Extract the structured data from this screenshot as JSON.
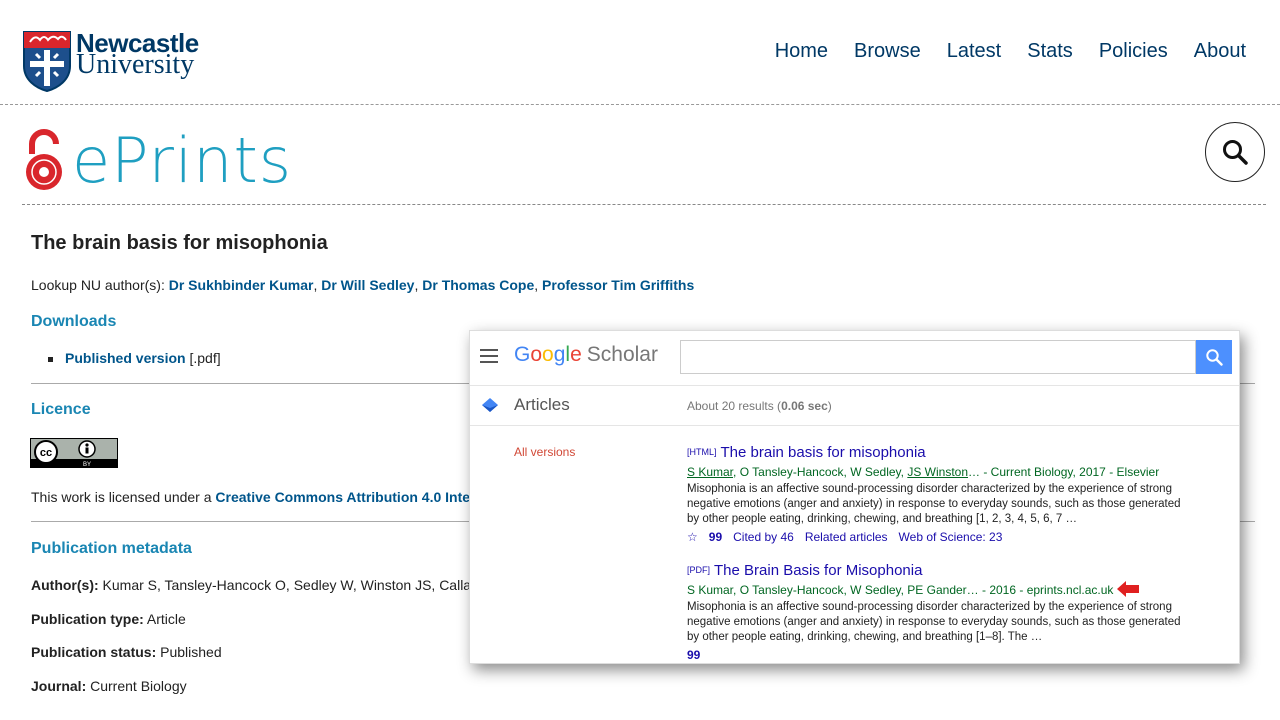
{
  "header": {
    "logo_line1": "Newcastle",
    "logo_line2": "University",
    "nav": [
      "Home",
      "Browse",
      "Latest",
      "Stats",
      "Policies",
      "About"
    ],
    "eprints_word": "ePrints"
  },
  "record": {
    "title": "The brain basis for misophonia",
    "lookup_label": "Lookup NU author(s): ",
    "authors": [
      "Dr Sukhbinder Kumar",
      "Dr Will Sedley",
      "Dr Thomas Cope",
      "Professor Tim Griffiths"
    ],
    "downloads_heading": "Downloads",
    "download_label": "Published version",
    "download_ext": " [.pdf]",
    "licence_heading": "Licence",
    "cc_badge": "CC BY",
    "license_prefix": "This work is licensed under a ",
    "license_link": "Creative Commons Attribution 4.0 Inte",
    "metadata_heading": "Publication metadata",
    "metadata": [
      {
        "label": "Author(s):",
        "value": "Kumar S, Tansley-Hancock O, Sedley W, Winston JS, Calla"
      },
      {
        "label": "Publication type:",
        "value": "Article"
      },
      {
        "label": "Publication status:",
        "value": "Published"
      },
      {
        "label": "Journal:",
        "value": "Current Biology"
      }
    ]
  },
  "scholar": {
    "logo_letters": [
      "G",
      "o",
      "o",
      "g",
      "l",
      "e"
    ],
    "logo_suffix": "Scholar",
    "search_value": "",
    "articles_label": "Articles",
    "results_prefix": "About 20 results (",
    "results_time": "0.06 sec",
    "results_suffix": ")",
    "all_versions": "All versions",
    "results": [
      {
        "tag": "[HTML]",
        "title": "The brain basis for misophonia",
        "src_author1": "S Kumar",
        "src_mid": ", O Tansley-Hancock, W Sedley, ",
        "src_author2": "JS Winston",
        "src_tail": "… - Current Biology, 2017 - Elsevier",
        "snippet": "Misophonia is an affective sound-processing disorder characterized by the experience of strong negative emotions (anger and anxiety) in response to everyday sounds, such as those generated by other people eating, drinking, chewing, and breathing [1, 2, 3, 4, 5, 6, 7 …",
        "cited_by": "Cited by 46",
        "related": "Related articles",
        "wos": "Web of Science: 23"
      },
      {
        "tag": "[PDF]",
        "title": "The Brain Basis for Misophonia",
        "src": "S Kumar, O Tansley-Hancock, W Sedley, PE Gander… - 2016 - eprints.ncl.ac.uk",
        "snippet": "Misophonia is an affective sound-processing disorder characterized by the experience of strong negative emotions (anger and anxiety) in response to everyday sounds, such as those generated by other people eating, drinking, chewing, and breathing [1–8]. The …"
      }
    ]
  },
  "colors": {
    "ncl_blue": "#003865",
    "eprints_teal": "#1f9fc1",
    "link_blue": "#00558b",
    "scholar_link": "#1a0dab",
    "scholar_green": "#006621",
    "arrow_red": "#e02020"
  },
  "icons": [
    "crest-icon",
    "open-access-lock-icon",
    "search-icon",
    "menu-icon",
    "scholar-cap-icon",
    "star-icon",
    "quote-icon",
    "red-arrow-icon"
  ]
}
